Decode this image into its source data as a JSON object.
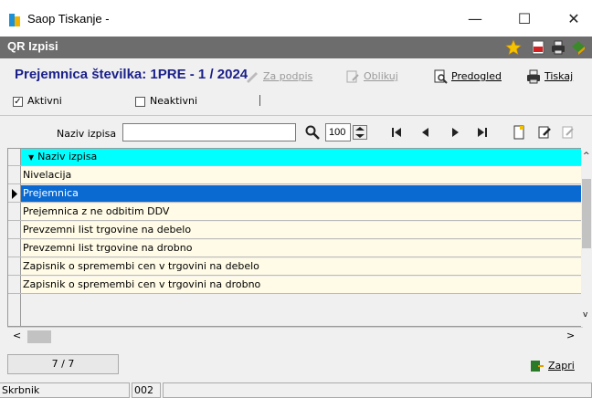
{
  "window": {
    "title": "Saop Tiskanje -",
    "minimize": "—",
    "maximize": "☐",
    "close": "✕"
  },
  "header": {
    "title": "QR Izpisi"
  },
  "toolbar": {
    "doc_title": "Prejemnica številka: 1PRE - 1 / 2024",
    "za_podpis": "Za podpis",
    "oblikuj": "Oblikuj",
    "predogled": "Predogled",
    "tiskaj": "Tiskaj"
  },
  "filters": {
    "aktivni": "Aktivni",
    "aktivni_checked": true,
    "neaktivni": "Neaktivni",
    "neaktivni_checked": false
  },
  "search": {
    "label": "Naziv izpisa",
    "value": "",
    "zoom": "100"
  },
  "grid": {
    "column": "Naziv izpisa",
    "rows": [
      "Nivelacija",
      "Prejemnica",
      "Prejemnica z ne odbitim DDV",
      "Prevzemni list trgovine na debelo",
      "Prevzemni list trgovine na drobno",
      "Zapisnik o spremembi cen v trgovini na debelo",
      "Zapisnik o spremembi cen v trgovini na drobno"
    ],
    "selected_index": 1
  },
  "status": {
    "record": "7 / 7",
    "zapri": "Zapri"
  },
  "bottom": {
    "user_label": "Skrbnik",
    "code": "002"
  }
}
